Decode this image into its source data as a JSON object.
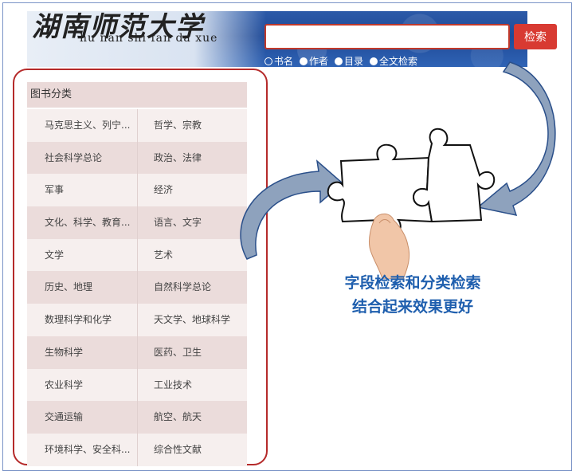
{
  "banner": {
    "title": "湖南师范大学",
    "subtitle": "hu nan shi fan da xue"
  },
  "search": {
    "value": "",
    "button_label": "检索",
    "options": [
      {
        "label": "书名",
        "selected": true
      },
      {
        "label": "作者",
        "selected": false
      },
      {
        "label": "目录",
        "selected": false
      },
      {
        "label": "全文检索",
        "selected": false
      }
    ]
  },
  "categories": {
    "header": "图书分类",
    "rows": [
      [
        "马克思主义、列宁...",
        "哲学、宗教"
      ],
      [
        "社会科学总论",
        "政治、法律"
      ],
      [
        "军事",
        "经济"
      ],
      [
        "文化、科学、教育...",
        "语言、文字"
      ],
      [
        "文学",
        "艺术"
      ],
      [
        "历史、地理",
        "自然科学总论"
      ],
      [
        "数理科学和化学",
        "天文学、地球科学"
      ],
      [
        "生物科学",
        "医药、卫生"
      ],
      [
        "农业科学",
        "工业技术"
      ],
      [
        "交通运输",
        "航空、航天"
      ],
      [
        "环境科学、安全科...",
        "综合性文献"
      ]
    ]
  },
  "caption": {
    "line1": "字段检索和分类检索",
    "line2": "结合起来效果更好"
  },
  "colors": {
    "accent": "#d83a32",
    "outline": "#b52a2a",
    "caption": "#1f5fae",
    "arrow": "#8ea2bd"
  }
}
